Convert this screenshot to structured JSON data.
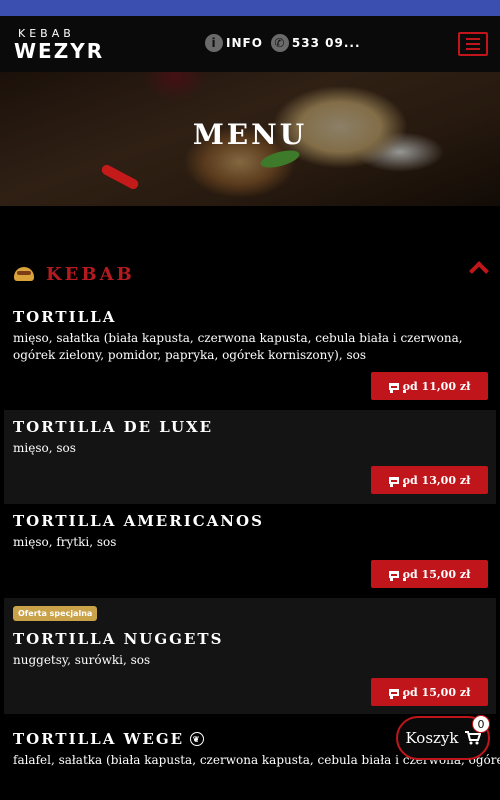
{
  "header": {
    "logo_top": "KEBAB",
    "logo_bottom": "WEZYR",
    "info_label": "INFO",
    "phone_label": "533 09..."
  },
  "hero": {
    "title": "MENU"
  },
  "category": {
    "title": "KEBAB"
  },
  "items": [
    {
      "name": "TORTILLA",
      "desc": "mięso, sałatka (biała kapusta, czerwona kapusta, cebula biała i czerwona, ogórek zielony, pomidor, papryka, ogórek korniszony), sos",
      "price": "od 11,00 zł"
    },
    {
      "name": "TORTILLA DE LUXE",
      "desc": "mięso, sos",
      "price": "od 13,00 zł"
    },
    {
      "name": "TORTILLA AMERICANOS",
      "desc": "mięso, frytki, sos",
      "price": "od 15,00 zł"
    },
    {
      "name": "TORTILLA NUGGETS",
      "desc": "nuggetsy, surówki, sos",
      "price": "od 15,00 zł",
      "badge": "Oferta specjalna"
    },
    {
      "name": "TORTILLA WEGE",
      "desc": "falafel, sałatka (biała kapusta, czerwona kapusta, cebula biała i czerwona, ogórek"
    }
  ],
  "cart": {
    "label": "Koszyk",
    "count": "0"
  },
  "colors": {
    "accent": "#c0161b",
    "topbar": "#3a4fb0",
    "badge": "#c9a24a"
  }
}
